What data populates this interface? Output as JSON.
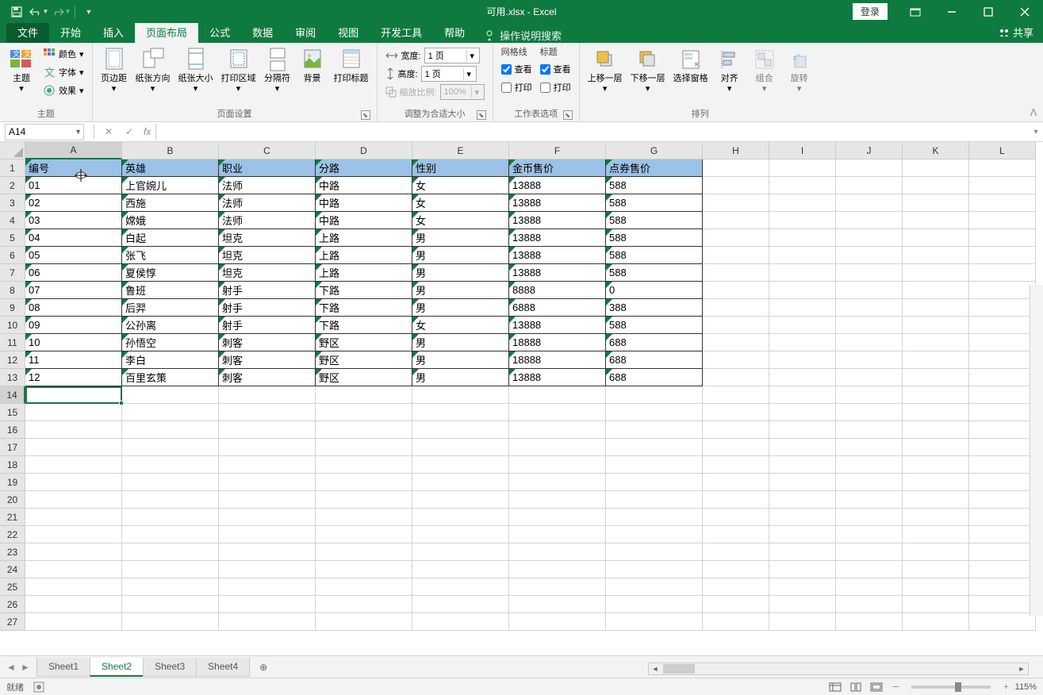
{
  "title": "可用.xlsx  -  Excel",
  "login": "登录",
  "tabs": {
    "file": "文件",
    "home": "开始",
    "insert": "插入",
    "layout": "页面布局",
    "formulas": "公式",
    "data": "数据",
    "review": "审阅",
    "view": "视图",
    "dev": "开发工具",
    "help": "帮助",
    "tellme": "操作说明搜索"
  },
  "share": "共享",
  "ribbon": {
    "themes": {
      "label": "主题",
      "colors": "颜色",
      "fonts": "字体",
      "effects": "效果",
      "themesBtn": "主题"
    },
    "pageSetup": {
      "label": "页面设置",
      "margins": "页边距",
      "orientation": "纸张方向",
      "size": "纸张大小",
      "printArea": "打印区域",
      "breaks": "分隔符",
      "background": "背景",
      "printTitles": "打印标题"
    },
    "scaleToFit": {
      "label": "调整为合适大小",
      "width": "宽度:",
      "height": "高度:",
      "scale": "缩放比例:",
      "widthVal": "1 页",
      "heightVal": "1 页",
      "scaleVal": "100%"
    },
    "sheetOptions": {
      "label": "工作表选项",
      "gridlines": "网格线",
      "headings": "标题",
      "view": "查看",
      "print": "打印"
    },
    "arrange": {
      "label": "排列",
      "bringForward": "上移一层",
      "sendBackward": "下移一层",
      "selectionPane": "选择窗格",
      "align": "对齐",
      "group": "组合",
      "rotate": "旋转"
    }
  },
  "namebox": "A14",
  "columns": [
    "A",
    "B",
    "C",
    "D",
    "E",
    "F",
    "G",
    "H",
    "I",
    "J",
    "K",
    "L"
  ],
  "headers": [
    "编号",
    "英雄",
    "职业",
    "分路",
    "性别",
    "金币售价",
    "点券售价"
  ],
  "rows": [
    [
      "01",
      "上官婉儿",
      "法师",
      "中路",
      "女",
      "13888",
      "588"
    ],
    [
      "02",
      "西施",
      "法师",
      "中路",
      "女",
      "13888",
      "588"
    ],
    [
      "03",
      "嫦娥",
      "法师",
      "中路",
      "女",
      "13888",
      "588"
    ],
    [
      "04",
      "白起",
      "坦克",
      "上路",
      "男",
      "13888",
      "588"
    ],
    [
      "05",
      "张飞",
      "坦克",
      "上路",
      "男",
      "13888",
      "588"
    ],
    [
      "06",
      "夏侯惇",
      "坦克",
      "上路",
      "男",
      "13888",
      "588"
    ],
    [
      "07",
      "鲁班",
      "射手",
      "下路",
      "男",
      "8888",
      "0"
    ],
    [
      "08",
      "后羿",
      "射手",
      "下路",
      "男",
      "6888",
      "388"
    ],
    [
      "09",
      "公孙离",
      "射手",
      "下路",
      "女",
      "13888",
      "588"
    ],
    [
      "10",
      "孙悟空",
      "刺客",
      "野区",
      "男",
      "18888",
      "688"
    ],
    [
      "11",
      "李白",
      "刺客",
      "野区",
      "男",
      "18888",
      "688"
    ],
    [
      "12",
      "百里玄策",
      "刺客",
      "野区",
      "男",
      "13888",
      "688"
    ]
  ],
  "sheets": [
    "Sheet1",
    "Sheet2",
    "Sheet3",
    "Sheet4"
  ],
  "activeSheet": 1,
  "status": "就绪",
  "zoom": "115%"
}
